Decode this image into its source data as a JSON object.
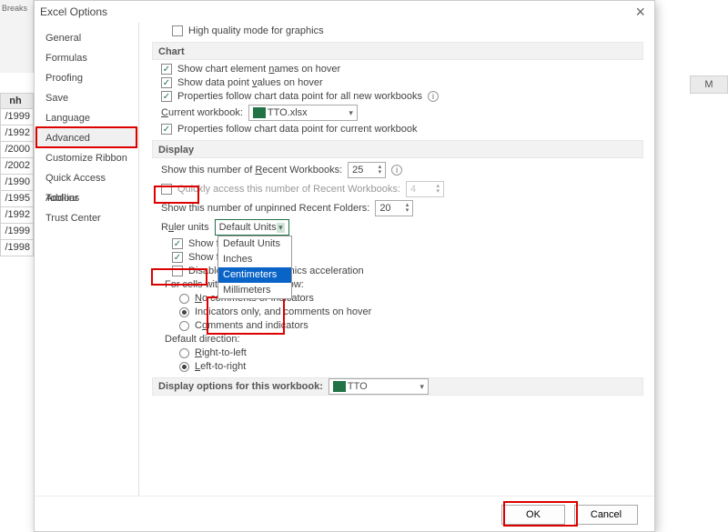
{
  "background": {
    "ribbon_label": "Breaks",
    "col_header": "nh",
    "col_m": "M",
    "years": [
      "/1999",
      "/1992",
      "/2000",
      "/2002",
      "/1990",
      "/1995",
      "/1992",
      "/1999",
      "/1998"
    ]
  },
  "dialog": {
    "title": "Excel Options"
  },
  "sidebar": {
    "items": [
      "General",
      "Formulas",
      "Proofing",
      "Save",
      "Language",
      "Advanced",
      "Customize Ribbon",
      "Quick Access Toolbar",
      "Add-ins",
      "Trust Center"
    ]
  },
  "sections": {
    "print": {
      "hq_graphics": "High quality mode for graphics"
    },
    "chart": {
      "title": "Chart",
      "show_names": "Show chart element names on hover",
      "show_values": "Show data point values on hover",
      "props_all": "Properties follow chart data point for all new workbooks",
      "current_wb": "Current workbook:",
      "wb_value": "TTO.xlsx",
      "props_current": "Properties follow chart data point for current workbook"
    },
    "display": {
      "title": "Display",
      "recent_wb": "Show this number of Recent Workbooks:",
      "recent_wb_val": "25",
      "quick_access": "Quickly access this number of Recent Workbooks:",
      "quick_access_val": "4",
      "recent_folders": "Show this number of unpinned Recent Folders:",
      "recent_folders_val": "20",
      "ruler_units": "Ruler units",
      "ruler_selected": "Default Units",
      "ruler_options": [
        "Default Units",
        "Inches",
        "Centimeters",
        "Millimeters"
      ],
      "show_formula_bar": "Show formula bar",
      "show_tooltips": "Show function ScreenTips",
      "disable_hw": "Disable hardware graphics acceleration",
      "comments_hdr": "For cells with comments, show:",
      "c_none": "No comments or indicators",
      "c_ind": "Indicators only, and comments on hover",
      "c_both": "Comments and indicators",
      "direction_hdr": "Default direction:",
      "dir_rtl": "Right-to-left",
      "dir_ltr": "Left-to-right"
    },
    "wb_display": {
      "title": "Display options for this workbook:",
      "value": "TTO"
    }
  },
  "footer": {
    "ok": "OK",
    "cancel": "Cancel"
  }
}
